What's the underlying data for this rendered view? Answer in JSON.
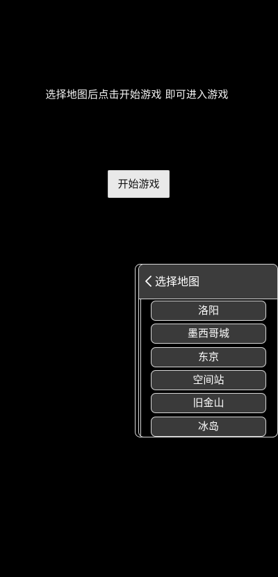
{
  "instruction": "选择地图后点击开始游戏 即可进入游戏",
  "start_button": {
    "label": "开始游戏"
  },
  "map_panel": {
    "title": "选择地图",
    "back_icon": "chevron-left-icon",
    "maps": [
      {
        "label": "洛阳"
      },
      {
        "label": "墨西哥城"
      },
      {
        "label": "东京"
      },
      {
        "label": "空间站"
      },
      {
        "label": "旧金山"
      },
      {
        "label": "冰岛"
      }
    ]
  },
  "colors": {
    "background": "#000000",
    "start_button_bg": "#e9e9e9",
    "panel_header_bg": "#3c3c3c",
    "map_item_bg": "#3a3a3a",
    "border": "#d8d8d8"
  }
}
